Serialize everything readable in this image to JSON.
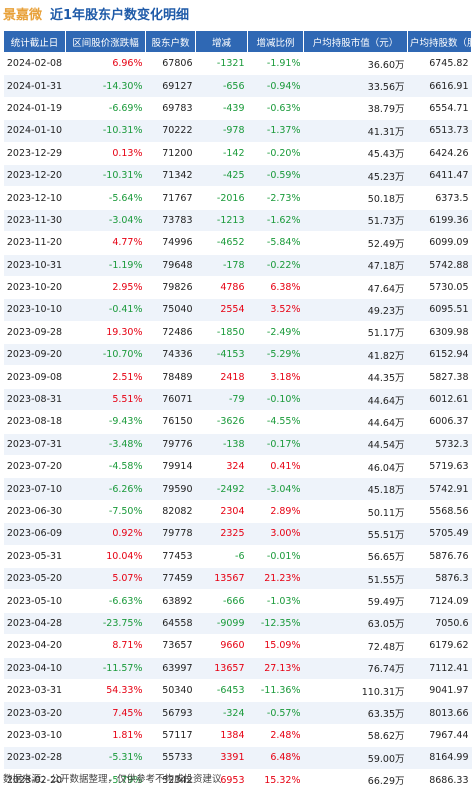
{
  "header": {
    "stock_name": "景嘉微",
    "title": "近1年股东户数变化明细"
  },
  "table": {
    "columns": [
      "统计截止日",
      "区间股价涨跌幅",
      "股东户数",
      "增减",
      "增减比例",
      "户均持股市值（元）",
      "户均持股数（股）"
    ],
    "rows": [
      [
        "2024-02-08",
        "6.96%",
        "67806",
        "-1321",
        "-1.91%",
        "36.60万",
        "6745.82"
      ],
      [
        "2024-01-31",
        "-14.30%",
        "69127",
        "-656",
        "-0.94%",
        "33.56万",
        "6616.91"
      ],
      [
        "2024-01-19",
        "-6.69%",
        "69783",
        "-439",
        "-0.63%",
        "38.79万",
        "6554.71"
      ],
      [
        "2024-01-10",
        "-10.31%",
        "70222",
        "-978",
        "-1.37%",
        "41.31万",
        "6513.73"
      ],
      [
        "2023-12-29",
        "0.13%",
        "71200",
        "-142",
        "-0.20%",
        "45.43万",
        "6424.26"
      ],
      [
        "2023-12-20",
        "-10.31%",
        "71342",
        "-425",
        "-0.59%",
        "45.23万",
        "6411.47"
      ],
      [
        "2023-12-10",
        "-5.64%",
        "71767",
        "-2016",
        "-2.73%",
        "50.18万",
        "6373.5"
      ],
      [
        "2023-11-30",
        "-3.04%",
        "73783",
        "-1213",
        "-1.62%",
        "51.73万",
        "6199.36"
      ],
      [
        "2023-11-20",
        "4.77%",
        "74996",
        "-4652",
        "-5.84%",
        "52.49万",
        "6099.09"
      ],
      [
        "2023-10-31",
        "-1.19%",
        "79648",
        "-178",
        "-0.22%",
        "47.18万",
        "5742.88"
      ],
      [
        "2023-10-20",
        "2.95%",
        "79826",
        "4786",
        "6.38%",
        "47.64万",
        "5730.05"
      ],
      [
        "2023-10-10",
        "-0.41%",
        "75040",
        "2554",
        "3.52%",
        "49.23万",
        "6095.51"
      ],
      [
        "2023-09-28",
        "19.30%",
        "72486",
        "-1850",
        "-2.49%",
        "51.17万",
        "6309.98"
      ],
      [
        "2023-09-20",
        "-10.70%",
        "74336",
        "-4153",
        "-5.29%",
        "41.82万",
        "6152.94"
      ],
      [
        "2023-09-08",
        "2.51%",
        "78489",
        "2418",
        "3.18%",
        "44.35万",
        "5827.38"
      ],
      [
        "2023-08-31",
        "5.51%",
        "76071",
        "-79",
        "-0.10%",
        "44.64万",
        "6012.61"
      ],
      [
        "2023-08-18",
        "-9.43%",
        "76150",
        "-3626",
        "-4.55%",
        "44.64万",
        "6006.37"
      ],
      [
        "2023-07-31",
        "-3.48%",
        "79776",
        "-138",
        "-0.17%",
        "44.54万",
        "5732.3"
      ],
      [
        "2023-07-20",
        "-4.58%",
        "79914",
        "324",
        "0.41%",
        "46.04万",
        "5719.63"
      ],
      [
        "2023-07-10",
        "-6.26%",
        "79590",
        "-2492",
        "-3.04%",
        "45.18万",
        "5742.91"
      ],
      [
        "2023-06-30",
        "-7.50%",
        "82082",
        "2304",
        "2.89%",
        "50.11万",
        "5568.56"
      ],
      [
        "2023-06-09",
        "0.92%",
        "79778",
        "2325",
        "3.00%",
        "55.51万",
        "5705.49"
      ],
      [
        "2023-05-31",
        "10.04%",
        "77453",
        "-6",
        "-0.01%",
        "56.65万",
        "5876.76"
      ],
      [
        "2023-05-20",
        "5.07%",
        "77459",
        "13567",
        "21.23%",
        "51.55万",
        "5876.3"
      ],
      [
        "2023-05-10",
        "-6.63%",
        "63892",
        "-666",
        "-1.03%",
        "59.49万",
        "7124.09"
      ],
      [
        "2023-04-28",
        "-23.75%",
        "64558",
        "-9099",
        "-12.35%",
        "63.05万",
        "7050.6"
      ],
      [
        "2023-04-20",
        "8.71%",
        "73657",
        "9660",
        "15.09%",
        "72.48万",
        "6179.62"
      ],
      [
        "2023-04-10",
        "-11.57%",
        "63997",
        "13657",
        "27.13%",
        "76.74万",
        "7112.41"
      ],
      [
        "2023-03-31",
        "54.33%",
        "50340",
        "-6453",
        "-11.36%",
        "110.31万",
        "9041.97"
      ],
      [
        "2023-03-20",
        "7.45%",
        "56793",
        "-324",
        "-0.57%",
        "63.35万",
        "8013.66"
      ],
      [
        "2023-03-10",
        "1.81%",
        "57117",
        "1384",
        "2.48%",
        "58.62万",
        "7967.44"
      ],
      [
        "2023-02-28",
        "-5.31%",
        "55733",
        "3391",
        "6.48%",
        "59.00万",
        "8164.99"
      ],
      [
        "2023-02-20",
        "-5.79%",
        "52342",
        "6953",
        "15.32%",
        "66.29万",
        "8686.33"
      ]
    ]
  },
  "footer": {
    "text": "数据来源：公开数据整理，仅供参考不构成投资建议"
  },
  "colors": {
    "header_bg": "#2f68b4",
    "up": "#e60012",
    "down": "#1a9a3a",
    "stock_name": "#e8a13a",
    "title": "#1e5aa8"
  }
}
